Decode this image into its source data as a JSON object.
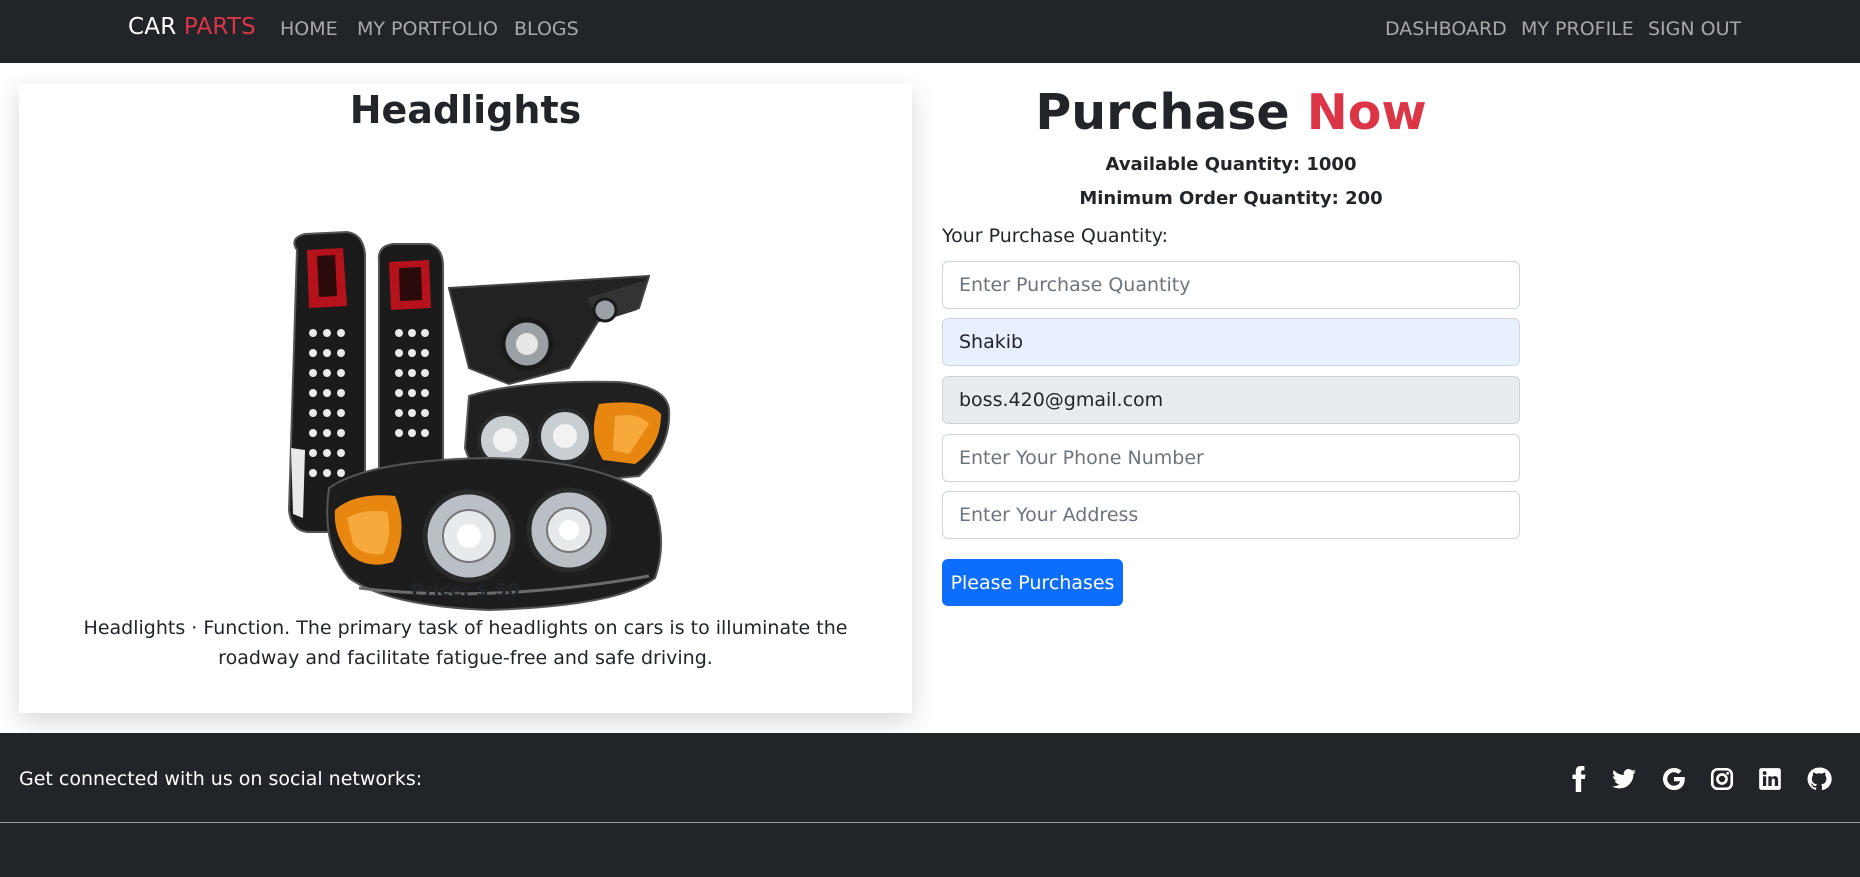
{
  "navbar": {
    "brand_part1": "CAR",
    "brand_part2": "PARTS",
    "left_links": [
      "HOME",
      "MY PORTFOLIO",
      "BLOGS"
    ],
    "right_links": [
      "DASHBOARD",
      "MY PROFILE",
      "SIGN OUT"
    ]
  },
  "product": {
    "title": "Headlights",
    "image_icon": "headlights-product-image",
    "price": "Price: $ 50",
    "description": "Headlights · Function. The primary task of headlights on cars is to illuminate the roadway and facilitate fatigue-free and safe driving."
  },
  "purchase": {
    "heading_part1": "Purchase",
    "heading_part2": "Now",
    "available": "Available Quantity: 1000",
    "minimum": "Minimum Order Quantity: 200",
    "quantity_label": "Your Purchase Quantity:",
    "quantity_placeholder": "Enter Purchase Quantity",
    "name_value": "Shakib",
    "email_value": "boss.420@gmail.com",
    "phone_placeholder": "Enter Your Phone Number",
    "address_placeholder": "Enter Your Address",
    "submit_label": "Please Purchases"
  },
  "footer": {
    "text": "Get connected with us on social networks:",
    "social_icons": [
      "facebook-icon",
      "twitter-icon",
      "google-icon",
      "instagram-icon",
      "linkedin-icon",
      "github-icon"
    ]
  },
  "colors": {
    "dark": "#212529",
    "accent_red": "#dc3545",
    "primary_blue": "#0d6efd",
    "autofill_blue": "#e8f0fe",
    "readonly_gray": "#e9ecef"
  }
}
